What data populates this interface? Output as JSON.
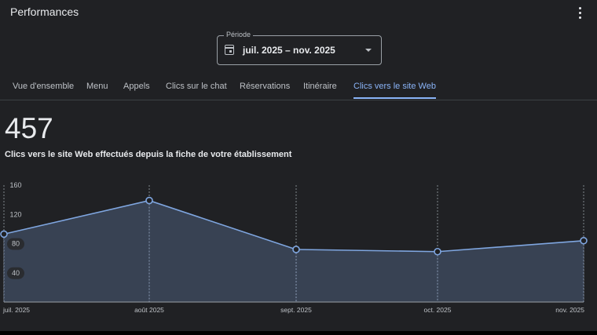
{
  "header": {
    "title": "Performances",
    "more_icon": "more-vert-icon"
  },
  "period": {
    "label": "Période",
    "value": "juil. 2025 – nov. 2025",
    "icon": "calendar-icon"
  },
  "tabs": [
    {
      "label": "Vue d'ensemble"
    },
    {
      "label": "Menu"
    },
    {
      "label": "Appels"
    },
    {
      "label": "Clics sur le chat"
    },
    {
      "label": "Réservations"
    },
    {
      "label": "Itinéraire"
    },
    {
      "label": "Clics vers le site Web",
      "active": true
    }
  ],
  "summary": {
    "total": "457",
    "description": "Clics vers le site Web effectués depuis la fiche de votre établissement"
  },
  "colors": {
    "accent": "#8ab4f8",
    "fill": "#3a4556",
    "line": "#7fa6e0"
  },
  "chart_data": {
    "type": "area",
    "categories": [
      "juil. 2025",
      "août 2025",
      "sept. 2025",
      "oct. 2025",
      "nov. 2025"
    ],
    "values": [
      93,
      139,
      72,
      69,
      84
    ],
    "yticks": [
      "160",
      "120",
      "80",
      "40"
    ],
    "ytick_values": [
      160,
      120,
      80,
      40
    ],
    "ylim": [
      0,
      160
    ],
    "grid": "vertical dotted"
  }
}
